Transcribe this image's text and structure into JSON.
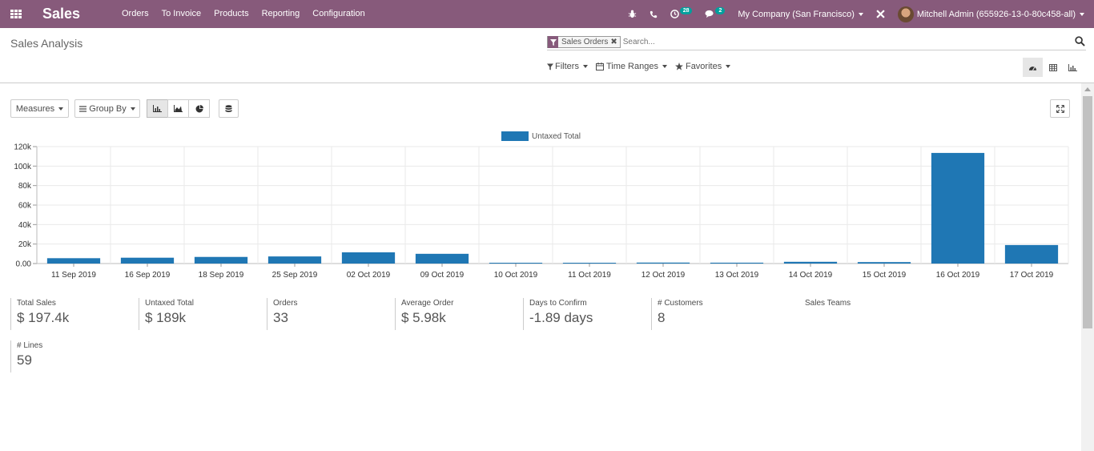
{
  "nav": {
    "brand": "Sales",
    "menu": [
      "Orders",
      "To Invoice",
      "Products",
      "Reporting",
      "Configuration"
    ],
    "activity_count": "28",
    "messages_count": "2",
    "company": "My Company (San Francisco)",
    "user": "Mitchell Admin (655926-13-0-80c458-all)"
  },
  "control_panel": {
    "title": "Sales Analysis",
    "facet": "Sales Orders",
    "search_placeholder": "Search...",
    "filters_label": "Filters",
    "time_ranges_label": "Time Ranges",
    "favorites_label": "Favorites"
  },
  "toolbar": {
    "measures_label": "Measures",
    "group_by_label": "Group By"
  },
  "chart_data": {
    "type": "bar",
    "legend_position": "top",
    "series": [
      {
        "name": "Untaxed Total",
        "values": [
          5500,
          6000,
          6800,
          7300,
          11500,
          10000,
          600,
          600,
          1000,
          900,
          1800,
          1500,
          113500,
          19000
        ]
      }
    ],
    "categories": [
      "11 Sep 2019",
      "16 Sep 2019",
      "18 Sep 2019",
      "25 Sep 2019",
      "02 Oct 2019",
      "09 Oct 2019",
      "10 Oct 2019",
      "11 Oct 2019",
      "12 Oct 2019",
      "13 Oct 2019",
      "14 Oct 2019",
      "15 Oct 2019",
      "16 Oct 2019",
      "17 Oct 2019"
    ],
    "yticks": [
      "0.00",
      "20k",
      "40k",
      "60k",
      "80k",
      "100k",
      "120k"
    ],
    "ylim": [
      0,
      120000
    ],
    "grid": true,
    "color": "#1f77b4"
  },
  "kpis": [
    {
      "label": "Total Sales",
      "value": "$ 197.4k"
    },
    {
      "label": "Untaxed Total",
      "value": "$ 189k"
    },
    {
      "label": "Orders",
      "value": "33"
    },
    {
      "label": "Average Order",
      "value": "$ 5.98k"
    },
    {
      "label": "Days to Confirm",
      "value": "-1.89 days"
    },
    {
      "label": "# Customers",
      "value": "8"
    },
    {
      "label": "Sales Teams",
      "value": ""
    },
    {
      "label": "# Lines",
      "value": "59"
    }
  ],
  "colors": {
    "nav": "#875a7b",
    "bar": "#1f77b4",
    "badge": "#00a09d"
  }
}
